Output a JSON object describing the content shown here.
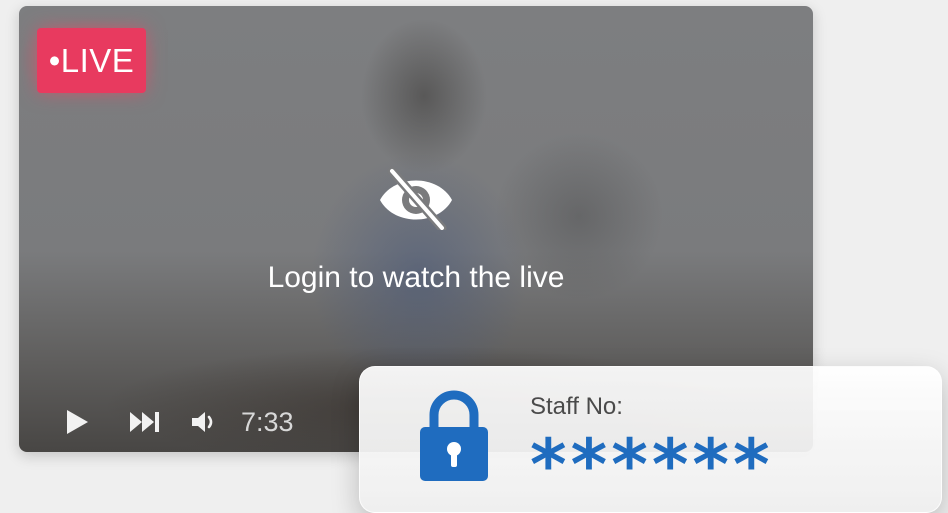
{
  "player": {
    "live_badge": "•LIVE",
    "overlay_icon": "eye-slash-icon",
    "overlay_message": "Login to watch the live",
    "controls": {
      "play_icon": "play-icon",
      "next_icon": "skip-next-icon",
      "volume_icon": "volume-icon",
      "time": "7:33"
    }
  },
  "staff_login": {
    "icon": "lock-icon",
    "label": "Staff No:",
    "value": "******"
  },
  "colors": {
    "live_red": "#e83a5f",
    "staff_blue": "#1f6cbf",
    "page_background": "#efefef"
  }
}
